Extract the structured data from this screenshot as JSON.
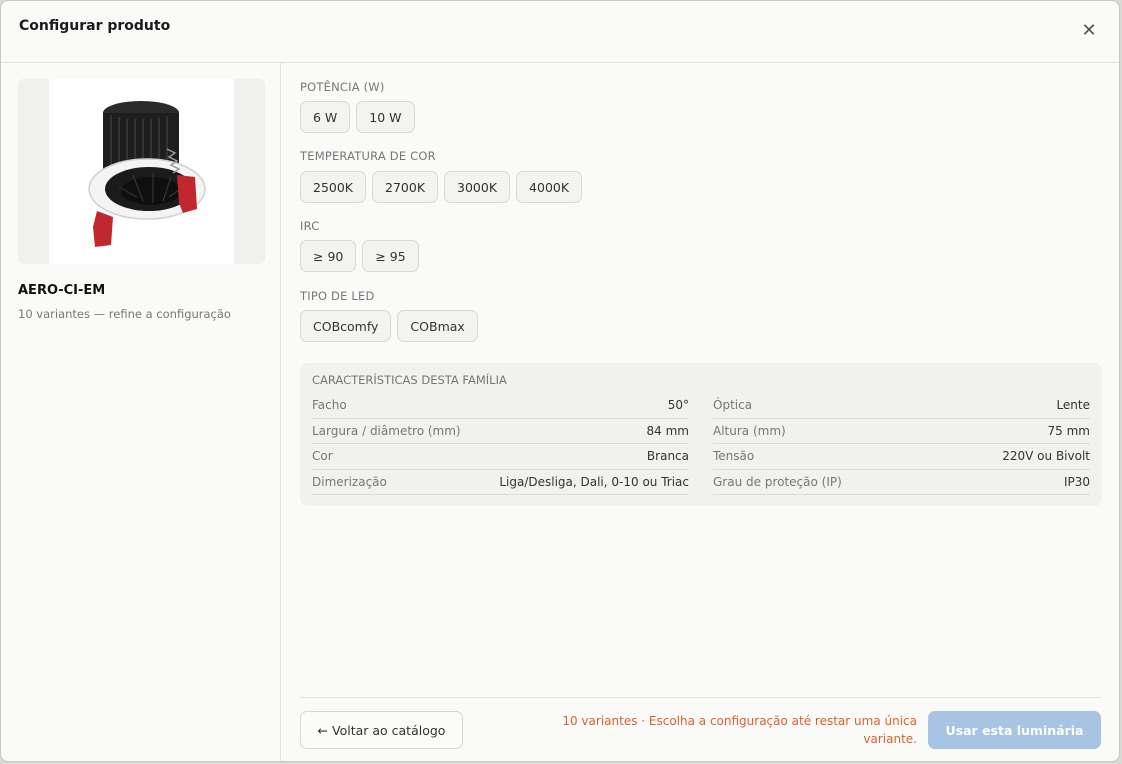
{
  "modal": {
    "title": "Configurar produto",
    "close_icon": "close-icon"
  },
  "product": {
    "image_icon": "downlight-product-image",
    "name": "AERO-CI-EM",
    "subtitle": "10 variantes — refine a configuração"
  },
  "options": [
    {
      "label": "POTÊNCIA (W)",
      "chips": [
        "6 W",
        "10 W"
      ]
    },
    {
      "label": "TEMPERATURA DE COR",
      "chips": [
        "2500K",
        "2700K",
        "3000K",
        "4000K"
      ]
    },
    {
      "label": "IRC",
      "chips": [
        "≥ 90",
        "≥ 95"
      ]
    },
    {
      "label": "TIPO DE LED",
      "chips": [
        "COBcomfy",
        "COBmax"
      ]
    }
  ],
  "specs": {
    "title": "CARACTERÍSTICAS DESTA FAMÍLIA",
    "left": [
      {
        "key": "Facho",
        "value": "50°"
      },
      {
        "key": "Largura / diâmetro (mm)",
        "value": "84 mm"
      },
      {
        "key": "Cor",
        "value": "Branca"
      },
      {
        "key": "Dimerização",
        "value": "Liga/Desliga, Dali, 0-10 ou Triac"
      }
    ],
    "right": [
      {
        "key": "Óptica",
        "value": "Lente"
      },
      {
        "key": "Altura (mm)",
        "value": "75 mm"
      },
      {
        "key": "Tensão",
        "value": "220V ou Bivolt"
      },
      {
        "key": "Grau de proteção (IP)",
        "value": "IP30"
      }
    ]
  },
  "footer": {
    "back_label": "← Voltar ao catálogo",
    "message": "10 variantes · Escolha a configuração até restar uma única variante.",
    "use_label": "Usar esta luminária"
  },
  "colors": {
    "accent_disabled": "#a7c4e4",
    "warning_text": "#d9622b"
  }
}
